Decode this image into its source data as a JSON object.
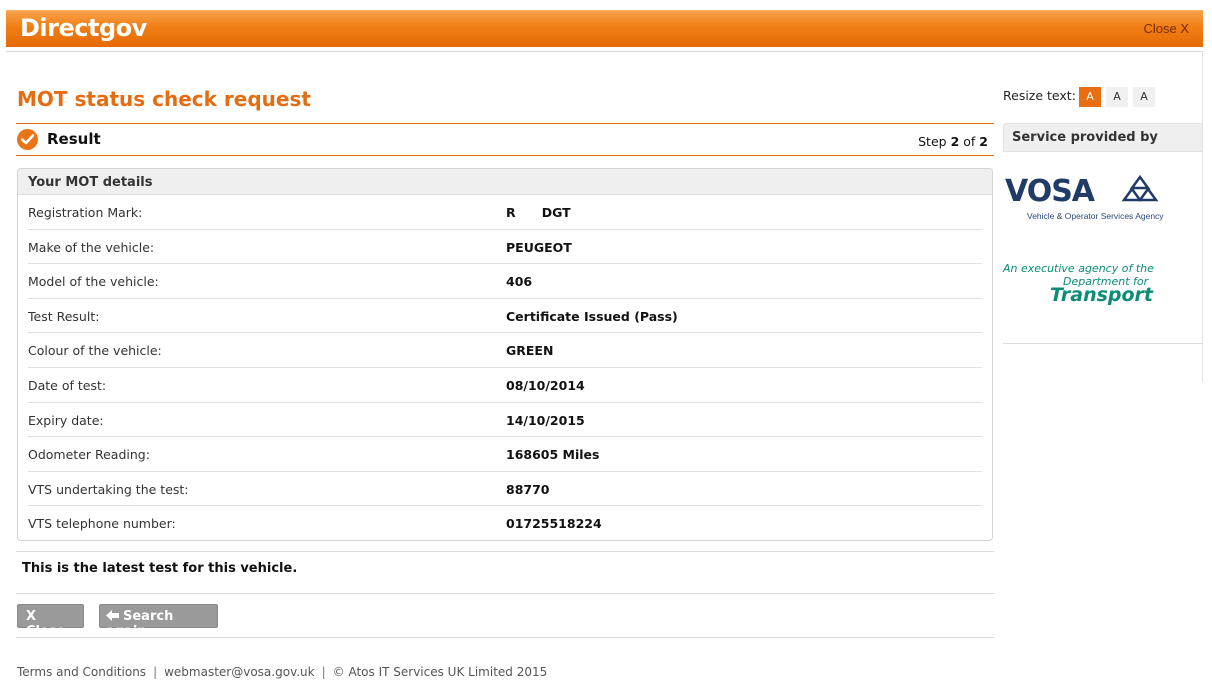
{
  "header": {
    "logo": "Directgov",
    "close_label": "Close X"
  },
  "page_title": "MOT status check request",
  "result": {
    "label": "Result",
    "step_prefix": "Step",
    "step_current": "2",
    "step_of": "of",
    "step_total": "2"
  },
  "details": {
    "heading": "Your MOT details",
    "rows": [
      {
        "label": "Registration Mark:",
        "value": "R      DGT"
      },
      {
        "label": "Make of the vehicle:",
        "value": "PEUGEOT"
      },
      {
        "label": "Model of the vehicle:",
        "value": "406"
      },
      {
        "label": "Test Result:",
        "value": "Certificate Issued (Pass)"
      },
      {
        "label": "Colour of the vehicle:",
        "value": "GREEN"
      },
      {
        "label": "Date of test:",
        "value": "08/10/2014"
      },
      {
        "label": "Expiry date:",
        "value": "14/10/2015"
      },
      {
        "label": "Odometer Reading:",
        "value": "168605 Miles"
      },
      {
        "label": "VTS undertaking the test:",
        "value": "88770"
      },
      {
        "label": "VTS telephone number:",
        "value": "01725518224"
      }
    ]
  },
  "latest_note": "This is the latest test for this vehicle.",
  "buttons": {
    "close": "X Close",
    "search_again": "Search again"
  },
  "footer": {
    "terms": "Terms and Conditions",
    "email": "webmaster@vosa.gov.uk",
    "copyright": "© Atos IT Services UK Limited 2015"
  },
  "sidebar": {
    "resize_label": "Resize text:",
    "resize_options": [
      "A",
      "A",
      "A"
    ],
    "service_heading": "Service provided by",
    "vosa_logo": "VOSA",
    "vosa_subtitle": "Vehicle & Operator Services Agency",
    "dft_line1": "An executive agency of the",
    "dft_line2": "Department for",
    "dft_line3": "Transport"
  },
  "colors": {
    "brand_orange": "#e46d12",
    "vosa_navy": "#1f3b66",
    "dft_green": "#0a8c76"
  }
}
